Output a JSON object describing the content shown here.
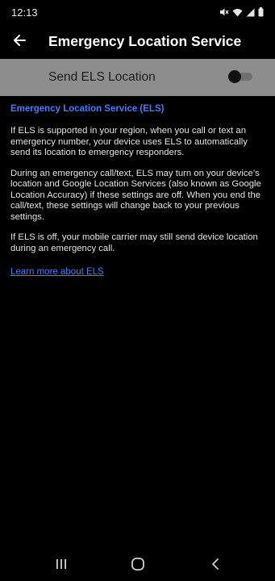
{
  "status_bar": {
    "time": "12:13",
    "icons": [
      "mute-icon",
      "wifi-icon",
      "signal-icon",
      "battery-icon"
    ]
  },
  "app_bar": {
    "back_icon": "arrow-left-icon",
    "title": "Emergency Location Service"
  },
  "toggle": {
    "label": "Send ELS Location",
    "state": "off"
  },
  "content": {
    "section_title": "Emergency Location Service (ELS)",
    "paragraphs": [
      "If ELS is supported in your region, when you call or text an emergency number, your device uses ELS to automatically send its location to emergency responders.",
      "During an emergency call/text, ELS may turn on your device’s location and Google Location Services (also known as Google Location Accuracy) if these settings are off. When you end the call/text, these settings will change back to your previous settings.",
      "If ELS is off, your mobile carrier may still send device location during an emergency call."
    ],
    "link": "Learn more about ELS"
  },
  "nav_bar": {
    "icons": [
      "recents-icon",
      "home-icon",
      "back-icon"
    ]
  },
  "colors": {
    "background": "#000000",
    "accent": "#3d7dff",
    "toggle_row": "#8d8d8d"
  }
}
